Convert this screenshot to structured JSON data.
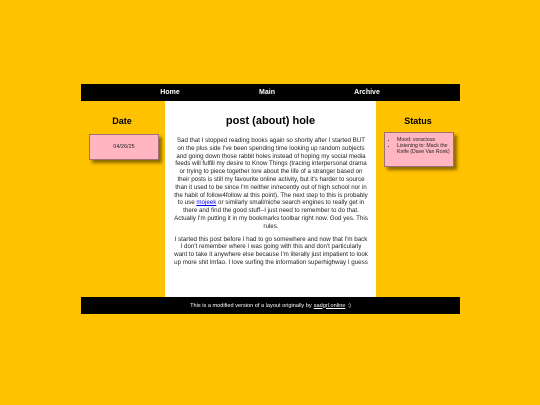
{
  "nav": {
    "home": "Home",
    "main": "Main",
    "archive": "Archive"
  },
  "date": {
    "heading": "Date",
    "value": "04/26/25"
  },
  "status": {
    "heading": "Status",
    "mood": "Mood: voracious",
    "listening": "Listening to: Mack the Knife (Dave Van Ronk)"
  },
  "post": {
    "title": "post (about) hole",
    "p1_before_link": "Sad that I stopped reading books again so shortly after I started BUT on the plus side I've been spending time looking up random subjects and going down those rabbit holes instead of hoping my social media feeds will fulfill my desire to Know Things (tracing interpersonal drama or trying to piece together lore about the life of a stranger based on their posts is still my favourite online activity, but it's harder to source than it used to be since I'm neither in/recently out of high school nor in the habit of follow4follow at this point). The next step to this is probably to use ",
    "p1_link": "mojeek",
    "p1_after_link": " or similarly small/niche search engines to really get in there and find the good stuff--I just need to remember to do that. Actually I'm putting it in my bookmarks toolbar right now. God yes. This rules.",
    "p2": "I started this post before I had to go somewhere and now that I'm back I don't remember where I was going with this and don't particularly want to take it anywhere else because I'm literally just impatient to look up more shit lmfao. I love surfing the information superhighway I guess"
  },
  "footer": {
    "text": "This is a modified version of a layout originally by",
    "link": "sadgrl.online",
    "tail": ":)"
  }
}
